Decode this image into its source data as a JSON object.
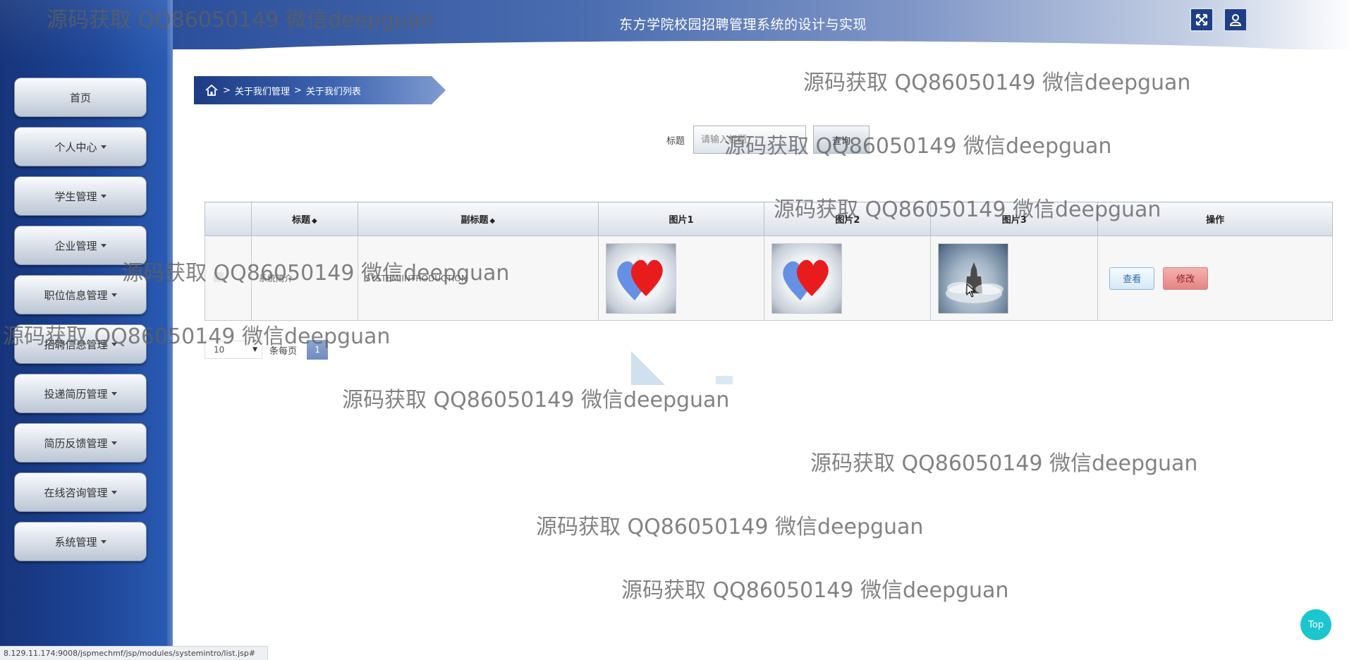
{
  "header": {
    "title": "东方学院校园招聘管理系统的设计与实现",
    "fullscreen_icon": "fullscreen-icon",
    "user_icon": "user-icon"
  },
  "sidebar": {
    "items": [
      {
        "label": "首页",
        "has_caret": false
      },
      {
        "label": "个人中心",
        "has_caret": true
      },
      {
        "label": "学生管理",
        "has_caret": true
      },
      {
        "label": "企业管理",
        "has_caret": true
      },
      {
        "label": "职位信息管理",
        "has_caret": true
      },
      {
        "label": "招聘信息管理",
        "has_caret": true
      },
      {
        "label": "投递简历管理",
        "has_caret": true
      },
      {
        "label": "简历反馈管理",
        "has_caret": true
      },
      {
        "label": "在线咨询管理",
        "has_caret": true
      },
      {
        "label": "系统管理",
        "has_caret": true
      }
    ]
  },
  "breadcrumb": {
    "home_icon": "home-icon",
    "sep": ">",
    "level1": "关于我们管理",
    "level2": "关于我们列表"
  },
  "search": {
    "label": "标题",
    "placeholder": "请输入标题",
    "button": "查询"
  },
  "table": {
    "columns": {
      "select": "",
      "title": "标题",
      "subtitle": "副标题",
      "image1": "图片1",
      "image2": "图片2",
      "image3": "图片3",
      "actions": "操作"
    },
    "sort_icon": "◆",
    "rows": [
      {
        "title": "系统简介",
        "subtitle": "SYSTEM INTRODUCTION",
        "view": "查看",
        "edit": "修改"
      }
    ]
  },
  "pagination": {
    "page_size": "10",
    "per_page_label": "条每页",
    "current_page": "1"
  },
  "watermark": "源码获取 QQ86050149 微信deepguan",
  "status_url": "8.129.11.174:9008/jspmechmf/jsp/modules/systemintro/list.jsp#",
  "top_button": "Top",
  "colors": {
    "sidebar": "#1d4597",
    "header_start": "#2b4f9b",
    "accent_top": "#1cc6cf",
    "edit_button": "#e48585",
    "view_button": "#d6e9f7"
  }
}
